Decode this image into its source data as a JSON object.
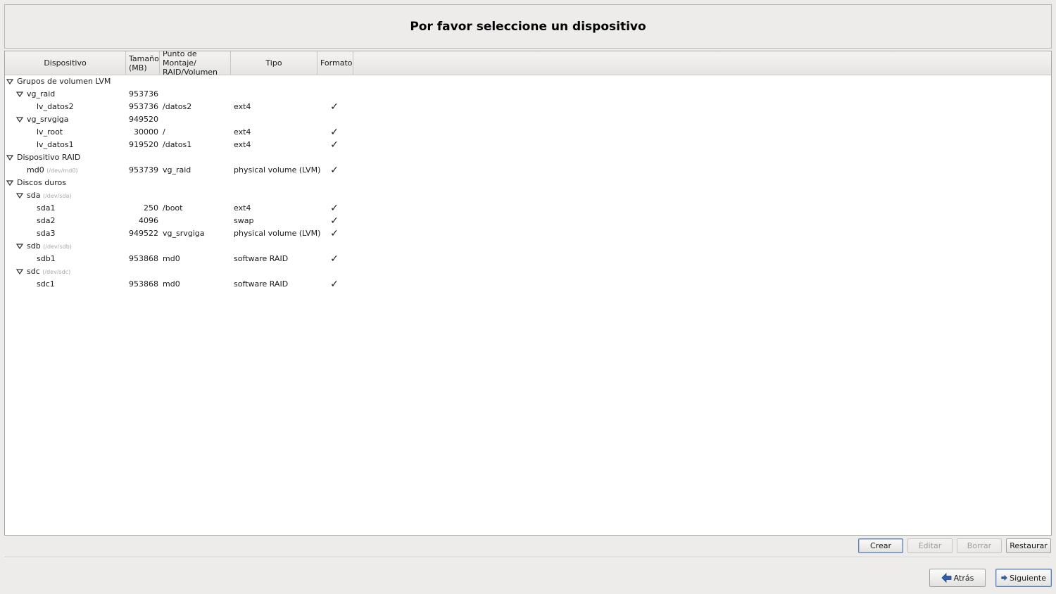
{
  "header": {
    "title": "Por favor seleccione un dispositivo"
  },
  "columns": {
    "device": "Dispositivo",
    "size_line1": "Tamaño",
    "size_line2": "(MB)",
    "mount_line1": "Punto de Montaje/",
    "mount_line2": "RAID/Volumen",
    "type": "Tipo",
    "format": "Formato"
  },
  "check_glyph": "✓",
  "rows": [
    {
      "label": "Grupos de volumen LVM",
      "path": "",
      "size": "",
      "mount": "",
      "type": "",
      "format": false
    },
    {
      "label": "vg_raid",
      "path": "",
      "size": "953736",
      "mount": "",
      "type": "",
      "format": false
    },
    {
      "label": "lv_datos2",
      "path": "",
      "size": "953736",
      "mount": "/datos2",
      "type": "ext4",
      "format": true
    },
    {
      "label": "vg_srvgiga",
      "path": "",
      "size": "949520",
      "mount": "",
      "type": "",
      "format": false
    },
    {
      "label": "lv_root",
      "path": "",
      "size": "30000",
      "mount": "/",
      "type": "ext4",
      "format": true
    },
    {
      "label": "lv_datos1",
      "path": "",
      "size": "919520",
      "mount": "/datos1",
      "type": "ext4",
      "format": true
    },
    {
      "label": "Dispositivo RAID",
      "path": "",
      "size": "",
      "mount": "",
      "type": "",
      "format": false
    },
    {
      "label": "md0",
      "path": "(/dev/md0)",
      "size": "953739",
      "mount": "vg_raid",
      "type": "physical volume (LVM)",
      "format": true
    },
    {
      "label": "Discos duros",
      "path": "",
      "size": "",
      "mount": "",
      "type": "",
      "format": false
    },
    {
      "label": "sda",
      "path": "(/dev/sda)",
      "size": "",
      "mount": "",
      "type": "",
      "format": false
    },
    {
      "label": "sda1",
      "path": "",
      "size": "250",
      "mount": "/boot",
      "type": "ext4",
      "format": true
    },
    {
      "label": "sda2",
      "path": "",
      "size": "4096",
      "mount": "",
      "type": "swap",
      "format": true
    },
    {
      "label": "sda3",
      "path": "",
      "size": "949522",
      "mount": "vg_srvgiga",
      "type": "physical volume (LVM)",
      "format": true
    },
    {
      "label": "sdb",
      "path": "(/dev/sdb)",
      "size": "",
      "mount": "",
      "type": "",
      "format": false
    },
    {
      "label": "sdb1",
      "path": "",
      "size": "953868",
      "mount": "md0",
      "type": "software RAID",
      "format": true
    },
    {
      "label": "sdc",
      "path": "(/dev/sdc)",
      "size": "",
      "mount": "",
      "type": "",
      "format": false
    },
    {
      "label": "sdc1",
      "path": "",
      "size": "953868",
      "mount": "md0",
      "type": "software RAID",
      "format": true
    }
  ],
  "actions": {
    "create": "Crear",
    "edit": "Editar",
    "delete": "Borrar",
    "reset": "Restaurar"
  },
  "nav": {
    "back": "Atrás",
    "next": "Siguiente"
  },
  "colors": {
    "focus_border": "#5c7fae",
    "nav_arrow": "#2f5fa8"
  }
}
